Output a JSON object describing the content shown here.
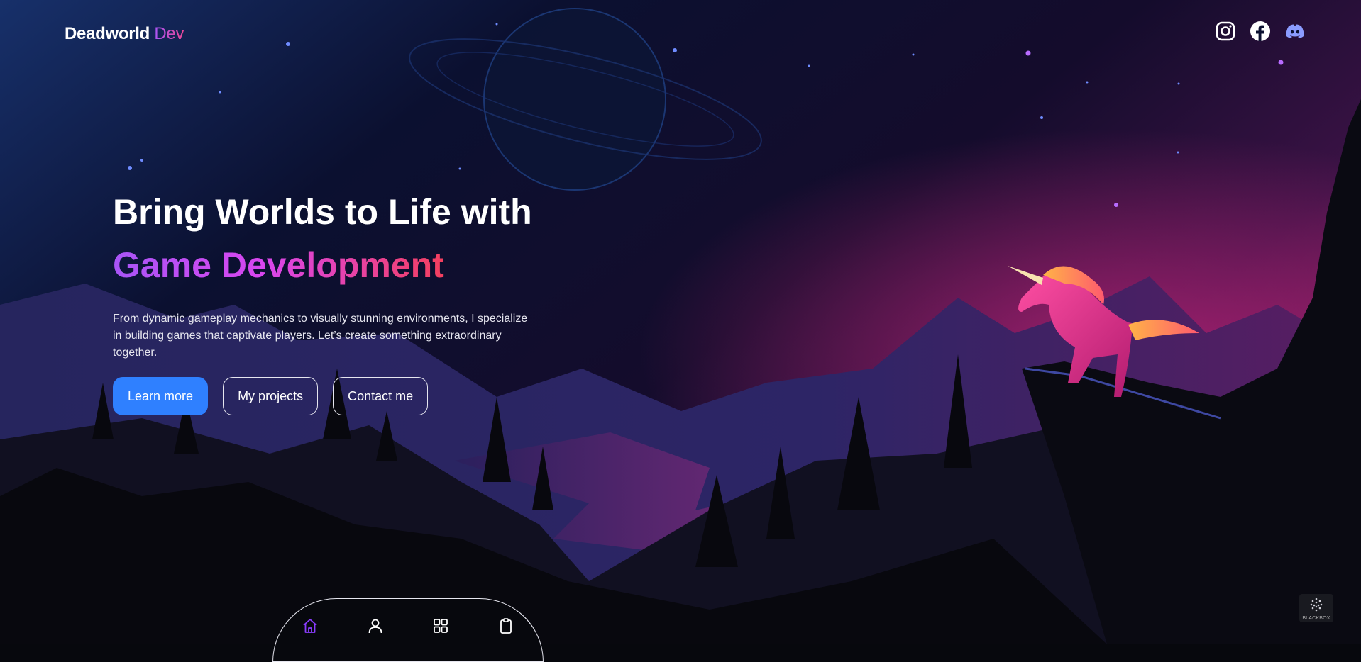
{
  "header": {
    "brand_main": "Deadworld",
    "brand_accent": "Dev",
    "socials": [
      {
        "icon": "instagram-icon",
        "color": "#ffffff"
      },
      {
        "icon": "facebook-icon",
        "color": "#ffffff"
      },
      {
        "icon": "discord-icon",
        "color": "#8b9cff"
      }
    ]
  },
  "hero": {
    "title_line1": "Bring Worlds to Life with",
    "title_line2": "Game Development",
    "description": "From dynamic gameplay mechanics to visually stunning environments, I specialize in building games that captivate players. Let’s create something extraordinary together.",
    "buttons": {
      "learn_more": "Learn more",
      "projects": "My projects",
      "contact": "Contact me"
    }
  },
  "dock": {
    "items": [
      {
        "icon": "home-icon",
        "active": true
      },
      {
        "icon": "user-icon",
        "active": false
      },
      {
        "icon": "grid-icon",
        "active": false
      },
      {
        "icon": "clipboard-icon",
        "active": false
      }
    ]
  },
  "watermark": {
    "label": "BLACKBOX"
  },
  "colors": {
    "primary_button": "#2f80ff",
    "gradient_start": "#a855f7",
    "gradient_end": "#f43f5e",
    "active_dock_icon": "#8b3dff"
  }
}
